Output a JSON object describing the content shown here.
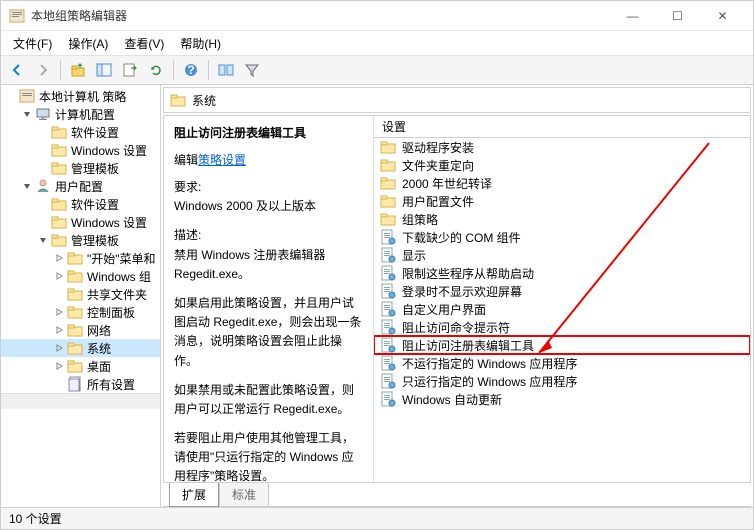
{
  "window": {
    "title": "本地组策略编辑器",
    "min": "—",
    "max": "☐",
    "close": "✕"
  },
  "menu": {
    "file": "文件(F)",
    "action": "操作(A)",
    "view": "查看(V)",
    "help": "帮助(H)"
  },
  "tree": {
    "root": "本地计算机 策略",
    "computer_config": "计算机配置",
    "software_settings": "软件设置",
    "windows_settings": "Windows 设置",
    "admin_templates": "管理模板",
    "user_config": "用户配置",
    "start_menu": "\"开始\"菜单和",
    "windows_components": "Windows 组",
    "shared_folders": "共享文件夹",
    "control_panel": "控制面板",
    "network": "网络",
    "system": "系统",
    "desktop": "桌面",
    "all_settings": "所有设置"
  },
  "path": {
    "name": "系统"
  },
  "desc": {
    "title": "阻止访问注册表编辑工具",
    "edit_label": "编辑",
    "edit_link": "策略设置",
    "req_label": "要求:",
    "req_text": "Windows 2000 及以上版本",
    "d_label": "描述:",
    "d1": "禁用 Windows 注册表编辑器 Regedit.exe。",
    "d2": "如果启用此策略设置，并且用户试图启动 Regedit.exe，则会出现一条消息，说明策略设置会阻止此操作。",
    "d3": "如果禁用或未配置此策略设置，则用户可以正常运行 Regedit.exe。",
    "d4": "若要阻止用户使用其他管理工具，请使用\"只运行指定的 Windows 应用程序\"策略设置。"
  },
  "list": {
    "header": "设置",
    "items": [
      {
        "type": "folder",
        "label": "驱动程序安装"
      },
      {
        "type": "folder",
        "label": "文件夹重定向"
      },
      {
        "type": "folder",
        "label": "2000 年世纪转译"
      },
      {
        "type": "folder",
        "label": "用户配置文件"
      },
      {
        "type": "folder",
        "label": "组策略"
      },
      {
        "type": "policy",
        "label": "下载缺少的 COM 组件"
      },
      {
        "type": "policy",
        "label": "显示"
      },
      {
        "type": "policy",
        "label": "限制这些程序从帮助启动"
      },
      {
        "type": "policy",
        "label": "登录时不显示欢迎屏幕"
      },
      {
        "type": "policy",
        "label": "自定义用户界面"
      },
      {
        "type": "policy",
        "label": "阻止访问命令提示符"
      },
      {
        "type": "policy",
        "label": "阻止访问注册表编辑工具",
        "highlight": true
      },
      {
        "type": "policy",
        "label": "不运行指定的 Windows 应用程序"
      },
      {
        "type": "policy",
        "label": "只运行指定的 Windows 应用程序"
      },
      {
        "type": "policy",
        "label": "Windows 自动更新"
      }
    ]
  },
  "tabs": {
    "extended": "扩展",
    "standard": "标准"
  },
  "status": {
    "count": "10 个设置"
  }
}
